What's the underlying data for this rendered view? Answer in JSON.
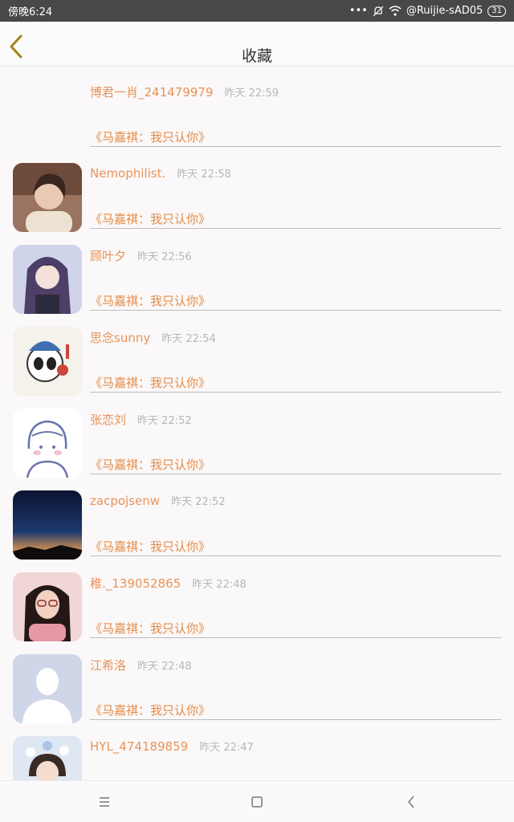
{
  "status_bar": {
    "time": "傍晚6:24",
    "network": "@Ruijie-sAD05",
    "battery": "31"
  },
  "header": {
    "title": "收藏",
    "back_icon": "chevron-left-icon"
  },
  "items": [
    {
      "name": "博君一肖_241479979",
      "time": "昨天 22:59",
      "link": "《马嘉祺：我只认你》",
      "avatar": "none"
    },
    {
      "name": "Nemophilist.",
      "time": "昨天 22:58",
      "link": "《马嘉祺：我只认你》",
      "avatar": "girl-photo"
    },
    {
      "name": "顾叶夕",
      "time": "昨天 22:56",
      "link": "《马嘉祺：我只认你》",
      "avatar": "anime-girl"
    },
    {
      "name": "思念sunny",
      "time": "昨天 22:54",
      "link": "《马嘉祺：我只认你》",
      "avatar": "panda-cartoon"
    },
    {
      "name": "张恋刘",
      "time": "昨天 22:52",
      "link": "《马嘉祺：我只认你》",
      "avatar": "line-drawing-girl"
    },
    {
      "name": "zacpojsenw",
      "time": "昨天 22:52",
      "link": "《马嘉祺：我只认你》",
      "avatar": "night-sky"
    },
    {
      "name": "稚._139052865",
      "time": "昨天 22:48",
      "link": "《马嘉祺：我只认你》",
      "avatar": "girl-glasses"
    },
    {
      "name": "江希洛",
      "time": "昨天 22:48",
      "link": "《马嘉祺：我只认你》",
      "avatar": "default-silhouette"
    },
    {
      "name": "HYL_474189859",
      "time": "昨天 22:47",
      "link": "",
      "avatar": "girl-flowers"
    }
  ],
  "nav_bar": {
    "menu_icon": "menu-icon",
    "home_icon": "home-icon",
    "back_icon": "back-icon"
  },
  "colors": {
    "name": "#e8935a",
    "link": "#e58a45",
    "time": "#b7b7b7",
    "status_bar": "#484848",
    "back_chevron": "#a0851a"
  }
}
